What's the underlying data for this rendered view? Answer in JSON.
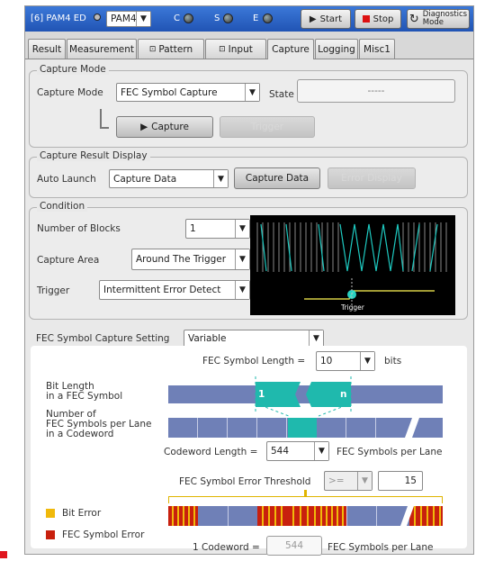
{
  "topbar": {
    "slot": "[6] PAM4 ED",
    "mode": "PAM4",
    "led_c": "C",
    "led_s": "S",
    "led_e": "E",
    "start": "Start",
    "stop": "Stop",
    "diag1": "Diagnostics",
    "diag2": "Mode"
  },
  "tabs": [
    "Result",
    "Measurement",
    "Pattern",
    "Input",
    "Capture",
    "Logging",
    "Misc1"
  ],
  "capture_mode": {
    "legend": "Capture Mode",
    "mode_label": "Capture Mode",
    "mode_value": "FEC Symbol Capture",
    "state_label": "State",
    "state_value": "-----",
    "capture_btn": "Capture",
    "trigger_btn": "Trigger"
  },
  "result_display": {
    "legend": "Capture Result Display",
    "auto_label": "Auto Launch",
    "auto_value": "Capture Data",
    "capture_data_btn": "Capture Data",
    "error_display_btn": "Error Display"
  },
  "condition": {
    "legend": "Condition",
    "blocks_label": "Number of Blocks",
    "blocks_value": "1",
    "area_label": "Capture Area",
    "area_value": "Around The Trigger",
    "trigger_label": "Trigger",
    "trigger_value": "Intermittent Error Detect",
    "scope_label": "Trigger"
  },
  "fec": {
    "legend": "FEC Symbol Capture Setting",
    "setting_value": "Variable",
    "symbol_length_label": "FEC Symbol Length =",
    "symbol_length_value": "10",
    "bits": "bits",
    "bit_length_label1": "Bit Length",
    "bit_length_label2": "in a FEC Symbol",
    "bar_start": "1",
    "bar_end": "n",
    "num_label1": "Number of",
    "num_label2": "FEC Symbols per Lane",
    "num_label3": "in a Codeword",
    "codeword_label": "Codeword Length =",
    "codeword_value": "544",
    "codeword_unit": "FEC Symbols per Lane",
    "threshold_label": "FEC Symbol Error Threshold",
    "threshold_op": ">=",
    "threshold_value": "15",
    "bit_error": "Bit Error",
    "symbol_error": "FEC Symbol Error",
    "one_codeword": "1 Codeword =",
    "one_codeword_value": "544",
    "one_codeword_unit": "FEC Symbols per Lane"
  },
  "colors": {
    "bar": "#6f80b7",
    "teal": "#1fb9ad",
    "bit_error": "#f0b90b",
    "symbol_error": "#c8200e"
  }
}
